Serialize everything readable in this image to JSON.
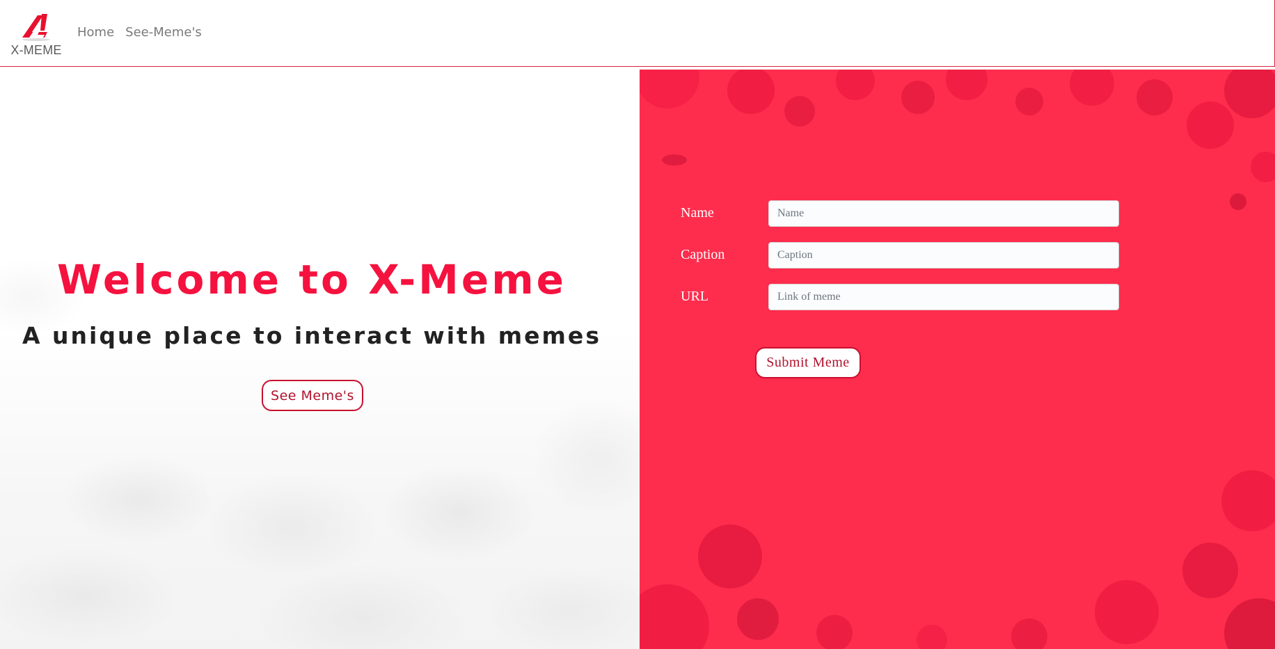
{
  "navbar": {
    "brand_text": "X-MEME",
    "links": [
      {
        "label": "Home"
      },
      {
        "label": "See-Meme's"
      }
    ]
  },
  "hero": {
    "title": "Welcome to X-Meme",
    "subtitle": "A unique place to interact with memes",
    "button_label": "See Meme's"
  },
  "form": {
    "fields": [
      {
        "label": "Name",
        "placeholder": "Name",
        "value": ""
      },
      {
        "label": "Caption",
        "placeholder": "Caption",
        "value": ""
      },
      {
        "label": "URL",
        "placeholder": "Link of meme",
        "value": ""
      }
    ],
    "submit_label": "Submit Meme"
  },
  "colors": {
    "accent": "#f5123f",
    "panel_bg": "#ff2d4d",
    "button_border": "#c8102e",
    "nav_border": "#d9233f"
  },
  "icons": {
    "logo": "x-meme-logo-icon"
  }
}
